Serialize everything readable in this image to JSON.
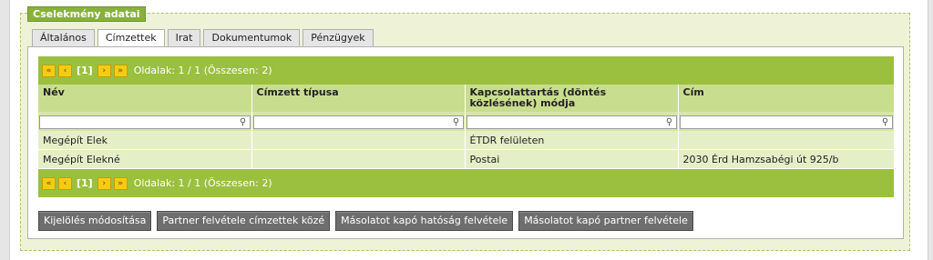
{
  "section": {
    "legend": "Cselekmény adatai"
  },
  "tabs": [
    {
      "label": "Általános"
    },
    {
      "label": "Címzettek"
    },
    {
      "label": "Irat"
    },
    {
      "label": "Dokumentumok"
    },
    {
      "label": "Pénzügyek"
    }
  ],
  "active_tab": "Címzettek",
  "pager": {
    "first": "«",
    "prev": "‹",
    "current": "[1]",
    "next": "›",
    "last": "»",
    "info": "Oldalak: 1 / 1 (Összesen: 2)"
  },
  "table": {
    "columns": [
      {
        "label": "Név"
      },
      {
        "label": "Címzett típusa"
      },
      {
        "label": "Kapcsolattartás (döntés közlésének) módja"
      },
      {
        "label": "Cím"
      }
    ],
    "filters": [
      "",
      "",
      "",
      ""
    ],
    "rows": [
      {
        "cells": [
          "Megépít Elek",
          "",
          "ÉTDR felületen",
          ""
        ]
      },
      {
        "cells": [
          "Megépít Elekné",
          "",
          "Postai",
          "2030 Érd Hamzsabégi út 925/b"
        ]
      }
    ]
  },
  "actions": [
    {
      "label": "Kijelölés módosítása"
    },
    {
      "label": "Partner felvétele címzettek közé"
    },
    {
      "label": "Másolatot kapó hatóság felvétele"
    },
    {
      "label": "Másolatot kapó partner felvétele"
    }
  ],
  "colors": {
    "pager_bg": "#9bc03f",
    "header_bg": "#c9dd8e",
    "row_bg": "#e5efc7",
    "legend_bg": "#88b13b",
    "button_bg": "#6e6e6e",
    "pager_button": "#f4cc14"
  }
}
